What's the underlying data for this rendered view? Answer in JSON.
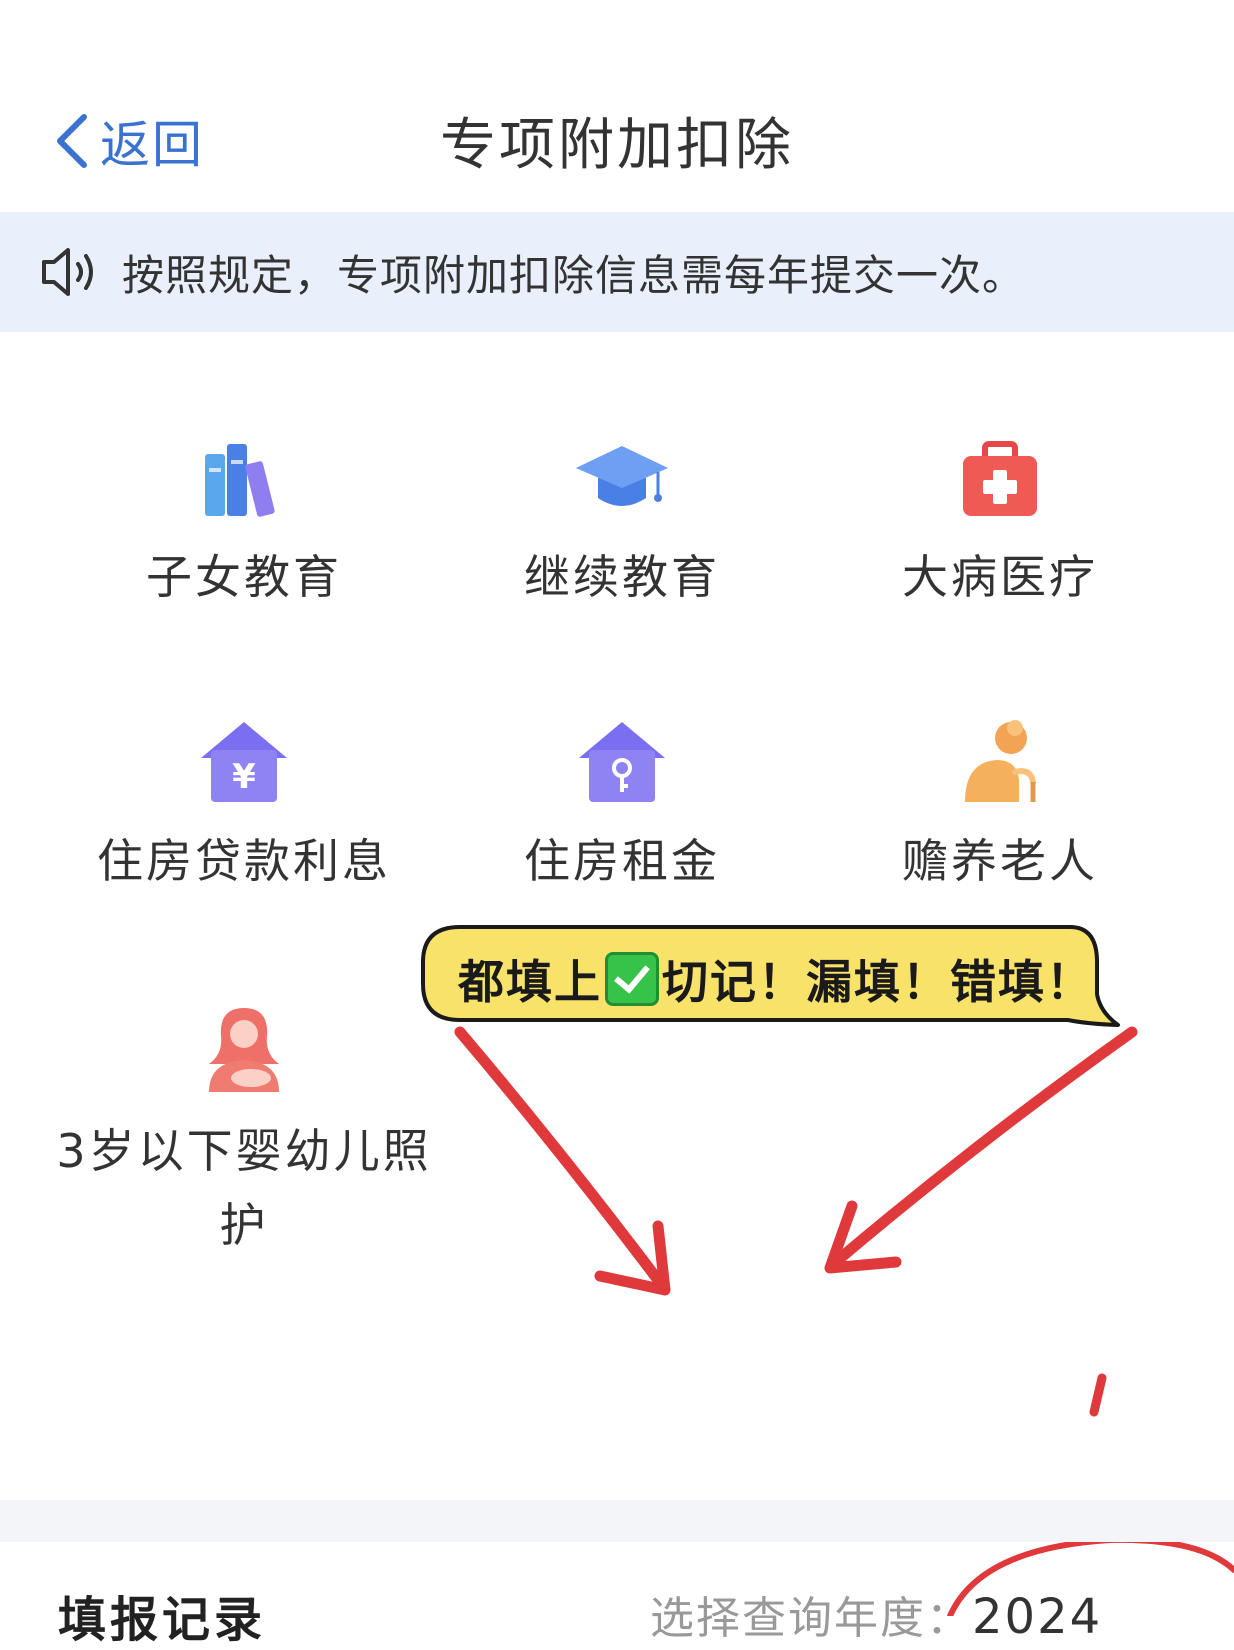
{
  "header": {
    "back_label": "返回",
    "title": "专项附加扣除"
  },
  "notice": {
    "text": "按照规定，专项附加扣除信息需每年提交一次。"
  },
  "deductions": [
    {
      "label": "子女教育",
      "icon": "books-icon"
    },
    {
      "label": "继续教育",
      "icon": "graduation-cap-icon"
    },
    {
      "label": "大病医疗",
      "icon": "first-aid-kit-icon"
    },
    {
      "label": "住房贷款利息",
      "icon": "house-yuan-icon"
    },
    {
      "label": "住房租金",
      "icon": "house-key-icon"
    },
    {
      "label": "赡养老人",
      "icon": "elderly-person-icon"
    },
    {
      "label": "3岁以下婴幼儿照护",
      "line1": "3岁以下婴幼儿照",
      "line2": "护",
      "icon": "mother-baby-icon"
    }
  ],
  "annotation": {
    "part1": "都填上",
    "part2": "切记！漏填！错填！",
    "check_icon": "check-mark-emoji"
  },
  "records": {
    "title": "填报记录",
    "year_label": "选择查询年度：",
    "year_value": "2024"
  },
  "colors": {
    "accent": "#3a72cf",
    "notice_bg": "#e9f0fb",
    "bubble_fill": "#f8e26a",
    "arrow_red": "#e0393b"
  }
}
